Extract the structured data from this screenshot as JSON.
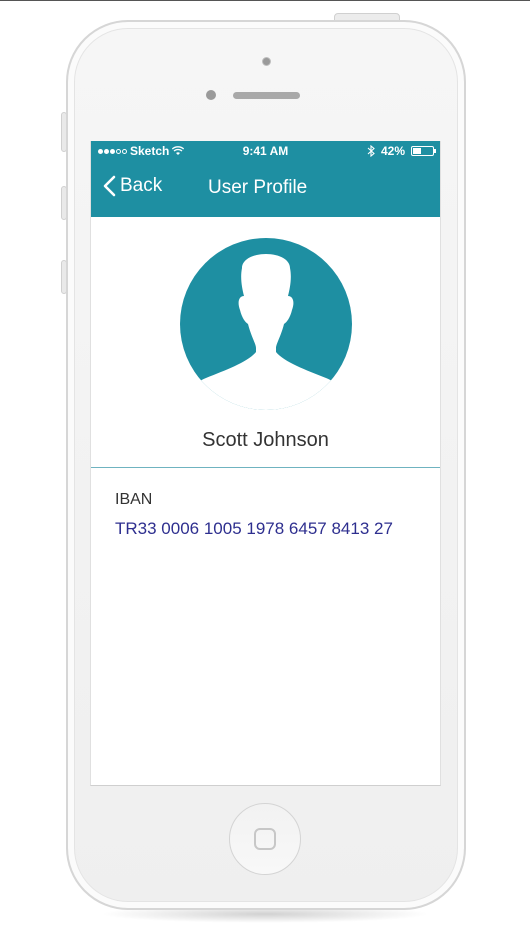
{
  "status_bar": {
    "carrier": "Sketch",
    "time": "9:41 AM",
    "battery_percent": "42%",
    "battery_level": 0.42,
    "signal_icon": "signal-dots-icon",
    "wifi_icon": "wifi-icon",
    "bluetooth_icon": "bluetooth-icon",
    "battery_icon": "battery-icon"
  },
  "nav": {
    "back_label": "Back",
    "back_icon": "chevron-left-icon",
    "title": "User Profile"
  },
  "profile": {
    "avatar_icon": "user-silhouette-icon",
    "name": "Scott Johnson"
  },
  "details": {
    "iban_label": "IBAN",
    "iban_value": "TR33 0006 1005 1978 6457 8413 27"
  },
  "colors": {
    "header": "#1e8fa2",
    "avatar": "#1e8fa2",
    "iban_value": "#2e2f8f",
    "divider": "#6fb3c0"
  }
}
